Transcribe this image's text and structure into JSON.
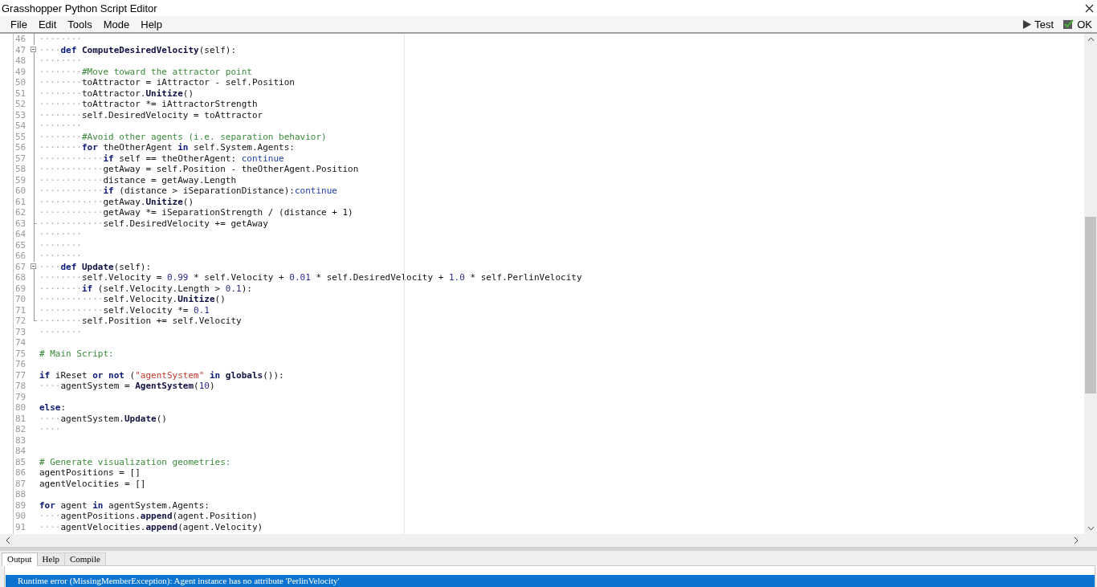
{
  "window": {
    "title": "Grasshopper Python Script Editor"
  },
  "menu": [
    "File",
    "Edit",
    "Tools",
    "Mode",
    "Help"
  ],
  "toolbar": [
    {
      "label": "Test",
      "kind": "run"
    },
    {
      "label": "OK",
      "kind": "confirm"
    }
  ],
  "editor": {
    "lines": [
      {
        "number": "46",
        "kind": "block",
        "tokens": [
          {
            "text": "········",
            "kind": "ws"
          }
        ]
      },
      {
        "number": "47",
        "kind": "head",
        "tokens": [
          {
            "text": "····",
            "kind": "ws"
          },
          {
            "text": "def ",
            "kind": "keyword"
          },
          {
            "text": "ComputeDesiredVelocity",
            "kind": "method"
          },
          {
            "text": "(self):",
            "kind": "plain"
          }
        ]
      },
      {
        "number": "48",
        "kind": "block",
        "tokens": [
          {
            "text": "········",
            "kind": "ws"
          }
        ]
      },
      {
        "number": "49",
        "kind": "block",
        "tokens": [
          {
            "text": "········",
            "kind": "ws"
          },
          {
            "text": "#Move toward the attractor point",
            "kind": "comment"
          }
        ]
      },
      {
        "number": "50",
        "kind": "block",
        "tokens": [
          {
            "text": "········",
            "kind": "ws"
          },
          {
            "text": "toAttractor = iAttractor - self.Position",
            "kind": "plain"
          }
        ]
      },
      {
        "number": "51",
        "kind": "block",
        "tokens": [
          {
            "text": "········",
            "kind": "ws"
          },
          {
            "text": "toAttractor.",
            "kind": "plain"
          },
          {
            "text": "Unitize",
            "kind": "method"
          },
          {
            "text": "()",
            "kind": "plain"
          }
        ]
      },
      {
        "number": "52",
        "kind": "block",
        "tokens": [
          {
            "text": "········",
            "kind": "ws"
          },
          {
            "text": "toAttractor *= iAttractorStrength",
            "kind": "plain"
          }
        ]
      },
      {
        "number": "53",
        "kind": "block",
        "tokens": [
          {
            "text": "········",
            "kind": "ws"
          },
          {
            "text": "self.DesiredVelocity = toAttractor",
            "kind": "plain"
          }
        ]
      },
      {
        "number": "54",
        "kind": "block",
        "tokens": [
          {
            "text": "········",
            "kind": "ws"
          }
        ]
      },
      {
        "number": "55",
        "kind": "block",
        "tokens": [
          {
            "text": "········",
            "kind": "ws"
          },
          {
            "text": "#Avoid other agents (i.e. separation behavior)",
            "kind": "comment"
          }
        ]
      },
      {
        "number": "56",
        "kind": "block",
        "tokens": [
          {
            "text": "········",
            "kind": "ws"
          },
          {
            "text": "for",
            "kind": "keyword"
          },
          {
            "text": " theOtherAgent ",
            "kind": "plain"
          },
          {
            "text": "in",
            "kind": "keyword"
          },
          {
            "text": " self.System.Agents:",
            "kind": "plain"
          }
        ]
      },
      {
        "number": "57",
        "kind": "block",
        "tokens": [
          {
            "text": "············",
            "kind": "ws"
          },
          {
            "text": "if",
            "kind": "keyword"
          },
          {
            "text": " self == theOtherAgent: ",
            "kind": "plain"
          },
          {
            "text": "continue",
            "kind": "soft"
          }
        ]
      },
      {
        "number": "58",
        "kind": "block",
        "tokens": [
          {
            "text": "············",
            "kind": "ws"
          },
          {
            "text": "getAway = self.Position - theOtherAgent.Position",
            "kind": "plain"
          }
        ]
      },
      {
        "number": "59",
        "kind": "block",
        "tokens": [
          {
            "text": "············",
            "kind": "ws"
          },
          {
            "text": "distance = getAway.Length",
            "kind": "plain"
          }
        ]
      },
      {
        "number": "60",
        "kind": "block",
        "tokens": [
          {
            "text": "············",
            "kind": "ws"
          },
          {
            "text": "if",
            "kind": "keyword"
          },
          {
            "text": " (distance > iSeparationDistance):",
            "kind": "plain"
          },
          {
            "text": "continue",
            "kind": "soft"
          }
        ]
      },
      {
        "number": "61",
        "kind": "block",
        "tokens": [
          {
            "text": "············",
            "kind": "ws"
          },
          {
            "text": "getAway.",
            "kind": "plain"
          },
          {
            "text": "Unitize",
            "kind": "method"
          },
          {
            "text": "()",
            "kind": "plain"
          }
        ]
      },
      {
        "number": "62",
        "kind": "block",
        "tokens": [
          {
            "text": "············",
            "kind": "ws"
          },
          {
            "text": "getAway *= iSeparationStrength / (distance + 1)",
            "kind": "plain"
          }
        ]
      },
      {
        "number": "63",
        "kind": "tick",
        "tokens": [
          {
            "text": "············",
            "kind": "ws"
          },
          {
            "text": "self.DesiredVelocity += getAway",
            "kind": "plain"
          }
        ]
      },
      {
        "number": "64",
        "kind": "block",
        "tokens": [
          {
            "text": "········",
            "kind": "ws"
          }
        ]
      },
      {
        "number": "65",
        "kind": "block",
        "tokens": [
          {
            "text": "········",
            "kind": "ws"
          }
        ]
      },
      {
        "number": "66",
        "kind": "block",
        "tokens": [
          {
            "text": "········",
            "kind": "ws"
          }
        ]
      },
      {
        "number": "67",
        "kind": "head",
        "tokens": [
          {
            "text": "····",
            "kind": "ws"
          },
          {
            "text": "def ",
            "kind": "keyword"
          },
          {
            "text": "Update",
            "kind": "method"
          },
          {
            "text": "(self):",
            "kind": "plain"
          }
        ]
      },
      {
        "number": "68",
        "kind": "block",
        "tokens": [
          {
            "text": "········",
            "kind": "ws"
          },
          {
            "text": "self.Velocity = ",
            "kind": "plain"
          },
          {
            "text": "0.99",
            "kind": "number"
          },
          {
            "text": " * self.Velocity + ",
            "kind": "plain"
          },
          {
            "text": "0.01",
            "kind": "number"
          },
          {
            "text": " * self.DesiredVelocity + ",
            "kind": "plain"
          },
          {
            "text": "1.0",
            "kind": "number"
          },
          {
            "text": " * self.PerlinVelocity",
            "kind": "plain"
          }
        ]
      },
      {
        "number": "69",
        "kind": "block",
        "tokens": [
          {
            "text": "········",
            "kind": "ws"
          },
          {
            "text": "if",
            "kind": "keyword"
          },
          {
            "text": " (self.Velocity.Length > ",
            "kind": "plain"
          },
          {
            "text": "0.1",
            "kind": "number"
          },
          {
            "text": "):",
            "kind": "plain"
          }
        ]
      },
      {
        "number": "70",
        "kind": "block",
        "tokens": [
          {
            "text": "············",
            "kind": "ws"
          },
          {
            "text": "self.Velocity.",
            "kind": "plain"
          },
          {
            "text": "Unitize",
            "kind": "method"
          },
          {
            "text": "()",
            "kind": "plain"
          }
        ]
      },
      {
        "number": "71",
        "kind": "block",
        "tokens": [
          {
            "text": "············",
            "kind": "ws"
          },
          {
            "text": "self.Velocity *= ",
            "kind": "plain"
          },
          {
            "text": "0.1",
            "kind": "number"
          }
        ]
      },
      {
        "number": "72",
        "kind": "tail",
        "tokens": [
          {
            "text": "········",
            "kind": "ws"
          },
          {
            "text": "self.Position += self.Velocity",
            "kind": "plain"
          }
        ]
      },
      {
        "number": "73",
        "tokens": [
          {
            "text": "········",
            "kind": "ws"
          }
        ]
      },
      {
        "number": "74"
      },
      {
        "number": "75",
        "tokens": [
          {
            "text": "# Main Script:",
            "kind": "comment"
          }
        ]
      },
      {
        "number": "76"
      },
      {
        "number": "77",
        "tokens": [
          {
            "text": "if",
            "kind": "keyword"
          },
          {
            "text": " iReset ",
            "kind": "plain"
          },
          {
            "text": "or not",
            "kind": "keyword"
          },
          {
            "text": " (",
            "kind": "plain"
          },
          {
            "text": "\"agentSystem\"",
            "kind": "string"
          },
          {
            "text": " in ",
            "kind": "keyword"
          },
          {
            "text": "globals",
            "kind": "method"
          },
          {
            "text": "()):",
            "kind": "plain"
          }
        ]
      },
      {
        "number": "78",
        "tokens": [
          {
            "text": "····",
            "kind": "ws"
          },
          {
            "text": "agentSystem = ",
            "kind": "plain"
          },
          {
            "text": "AgentSystem",
            "kind": "method"
          },
          {
            "text": "(",
            "kind": "plain"
          },
          {
            "text": "10",
            "kind": "number"
          },
          {
            "text": ")",
            "kind": "plain"
          }
        ]
      },
      {
        "number": "79"
      },
      {
        "number": "80",
        "tokens": [
          {
            "text": "else",
            "kind": "keyword"
          },
          {
            "text": ":",
            "kind": "plain"
          }
        ]
      },
      {
        "number": "81",
        "tokens": [
          {
            "text": "····",
            "kind": "ws"
          },
          {
            "text": "agentSystem.",
            "kind": "plain"
          },
          {
            "text": "Update",
            "kind": "method"
          },
          {
            "text": "()",
            "kind": "plain"
          }
        ]
      },
      {
        "number": "82",
        "tokens": [
          {
            "text": "····",
            "kind": "ws"
          }
        ]
      },
      {
        "number": "83"
      },
      {
        "number": "84"
      },
      {
        "number": "85",
        "tokens": [
          {
            "text": "# Generate visualization geometries:",
            "kind": "comment"
          }
        ]
      },
      {
        "number": "86",
        "tokens": [
          {
            "text": "agentPositions = []",
            "kind": "plain"
          }
        ]
      },
      {
        "number": "87",
        "tokens": [
          {
            "text": "agentVelocities = []",
            "kind": "plain"
          }
        ]
      },
      {
        "number": "88"
      },
      {
        "number": "89",
        "tokens": [
          {
            "text": "for",
            "kind": "keyword"
          },
          {
            "text": " agent ",
            "kind": "plain"
          },
          {
            "text": "in",
            "kind": "keyword"
          },
          {
            "text": " agentSystem.Agents:",
            "kind": "plain"
          }
        ]
      },
      {
        "number": "90",
        "tokens": [
          {
            "text": "····",
            "kind": "ws"
          },
          {
            "text": "agentPositions.",
            "kind": "plain"
          },
          {
            "text": "append",
            "kind": "method"
          },
          {
            "text": "(agent.Position)",
            "kind": "plain"
          }
        ]
      },
      {
        "number": "91",
        "tokens": [
          {
            "text": "····",
            "kind": "ws"
          },
          {
            "text": "agentVelocities.",
            "kind": "plain"
          },
          {
            "text": "append",
            "kind": "method"
          },
          {
            "text": "(agent.Velocity)",
            "kind": "plain"
          }
        ]
      }
    ]
  },
  "tabs": [
    {
      "label": "Output",
      "selected": true
    },
    {
      "label": "Help",
      "selected": false
    },
    {
      "label": "Compile",
      "selected": false
    }
  ],
  "output": [
    {
      "text": "Runtime error (MissingMemberException): Agent instance has no attribute 'PerlinVelocity'",
      "selected": true
    }
  ]
}
